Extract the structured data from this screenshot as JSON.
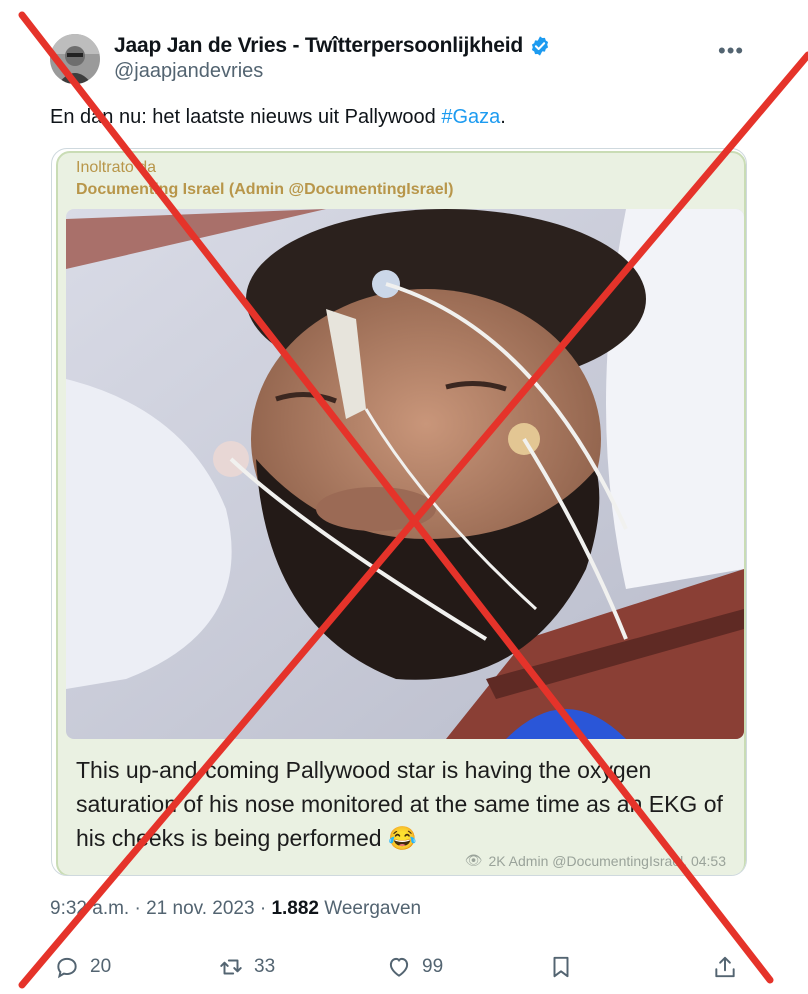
{
  "author": {
    "display_name": "Jaap Jan de Vries - Twîtterpersoonlijkheid",
    "handle": "@jaapjandevries",
    "verified": true
  },
  "more_icon": "more-horizontal-icon",
  "tweet": {
    "text_prefix": "En dan nu: het laatste nieuws uit Pallywood ",
    "hashtag": "#Gaza",
    "text_suffix": "."
  },
  "media": {
    "forward_label": "Inoltrato da",
    "forward_source": "Documenting Israel (Admin @DocumentingIsrael)",
    "caption": "This up-and-coming Pallywood star is having the oxygen saturation of his nose monitored at the same time as an EKG of his cheeks is being performed 😂",
    "meta": "2K Admin @DocumentingIsrael, 04:53"
  },
  "timestamp": {
    "time_date": "9:32 a.m. · 21 nov. 2023 · ",
    "views_count": "1.882",
    "views_label": " Weergaven"
  },
  "actions": {
    "replies": "20",
    "retweets": "33",
    "likes": "99"
  },
  "colors": {
    "link": "#1d9bf0",
    "verified": "#1d9bf0",
    "cross": "#e5332a"
  }
}
